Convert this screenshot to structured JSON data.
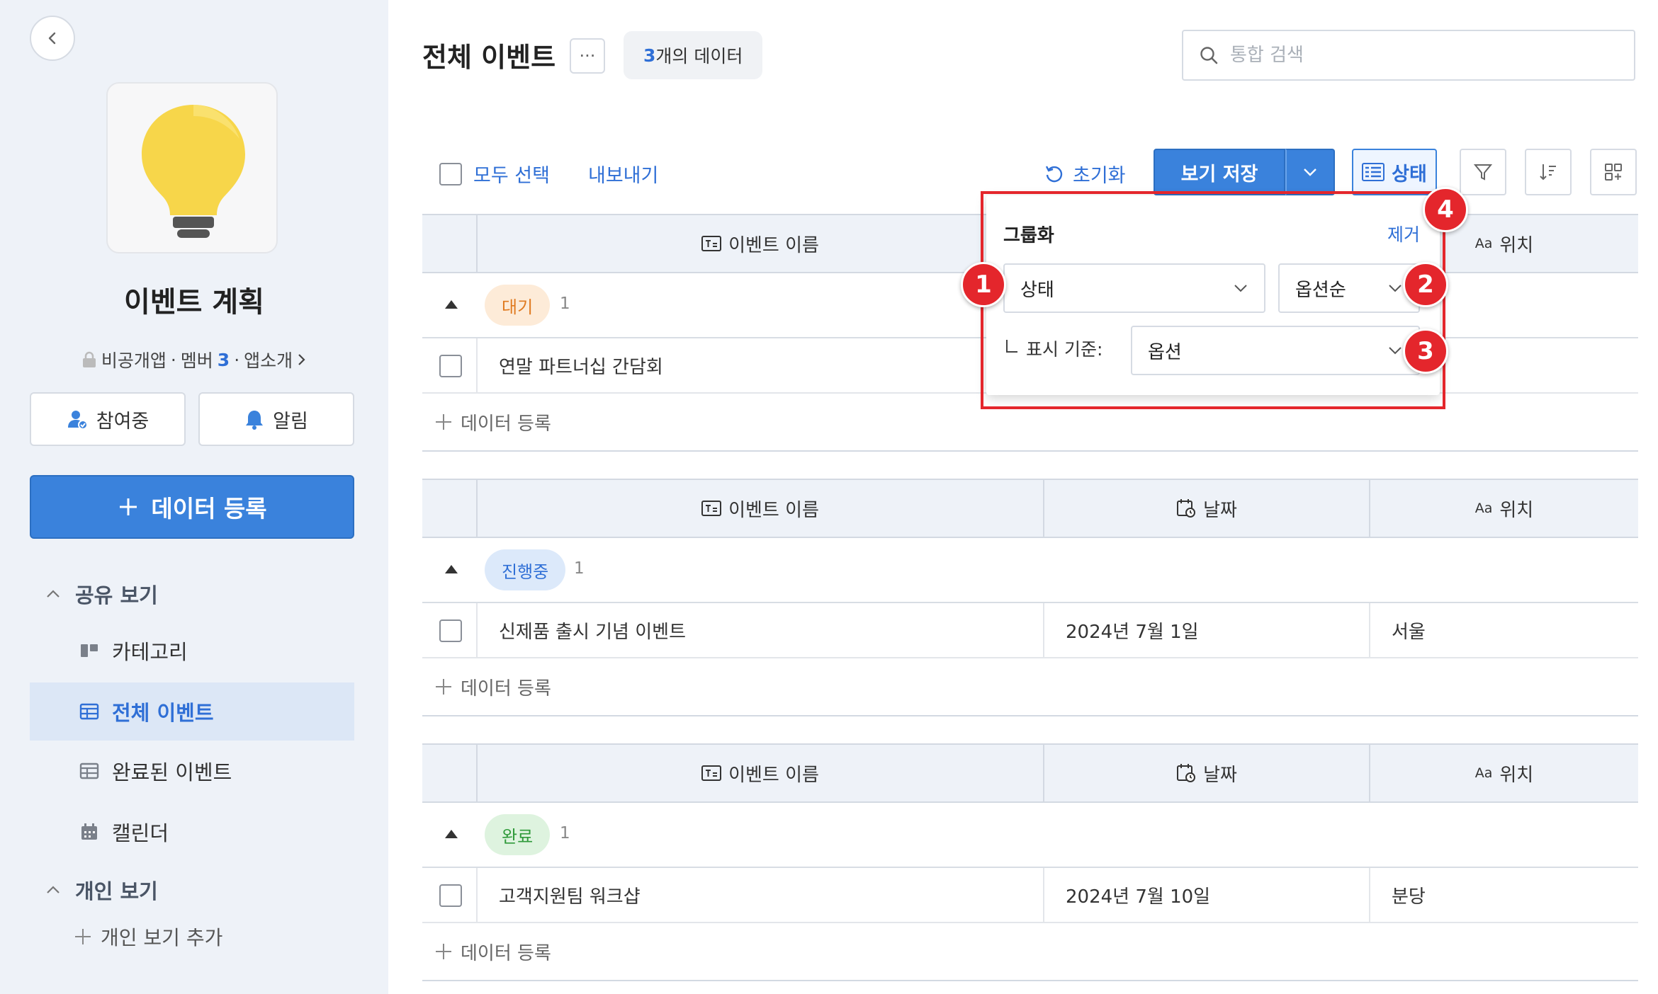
{
  "sidebar": {
    "app_name": "이벤트 계획",
    "meta": {
      "visibility": "비공개앱",
      "member_label": "멤버",
      "member_count": "3",
      "intro": "앱소개"
    },
    "join_label": "참여중",
    "alert_label": "알림",
    "register_label": "데이터 등록",
    "shared_section": "공유 보기",
    "shared_items": [
      "카테고리",
      "전체 이벤트",
      "완료된 이벤트",
      "캘린더"
    ],
    "personal_section": "개인 보기",
    "personal_add": "개인 보기 추가"
  },
  "header": {
    "title": "전체 이벤트",
    "count_num": "3",
    "count_suffix": "개의 데이터",
    "search_placeholder": "통합 검색"
  },
  "toolbar": {
    "select_all": "모두 선택",
    "export": "내보내기",
    "reset": "초기화",
    "save_view": "보기 저장",
    "status": "상태"
  },
  "columns": {
    "name": "이벤트 이름",
    "date": "날짜",
    "location_prefix": "Aa",
    "location": "위치"
  },
  "groups": [
    {
      "tag": "대기",
      "count": "1",
      "rows": [
        {
          "name": "연말 파트너십 간담회",
          "date": "",
          "location": ""
        }
      ],
      "add": "데이터 등록"
    },
    {
      "tag": "진행중",
      "count": "1",
      "rows": [
        {
          "name": "신제품 출시 기념 이벤트",
          "date": "2024년 7월 1일",
          "location": "서울"
        }
      ],
      "add": "데이터 등록"
    },
    {
      "tag": "완료",
      "count": "1",
      "rows": [
        {
          "name": "고객지원팀 워크샵",
          "date": "2024년 7월 10일",
          "location": "분당"
        }
      ],
      "add": "데이터 등록"
    }
  ],
  "popover": {
    "title": "그룹화",
    "remove": "제거",
    "group_field": "상태",
    "order": "옵션순",
    "display_label": "표시 기준:",
    "display_value": "옵션"
  },
  "markers": [
    "1",
    "2",
    "3",
    "4"
  ],
  "colors": {
    "accent": "#3a82dc",
    "highlight": "#e4262c",
    "tag_waiting_bg": "#fdebd8",
    "tag_waiting_fg": "#e07a1f",
    "tag_progress_bg": "#dce9fa",
    "tag_progress_fg": "#2f6fd6",
    "tag_done_bg": "#def3df",
    "tag_done_fg": "#2f9a3a"
  }
}
